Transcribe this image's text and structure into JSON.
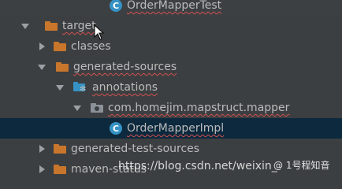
{
  "tree": {
    "rows": [
      {
        "label": "OrderMapperTest",
        "kind": "class",
        "expanded": null
      },
      {
        "label": "target",
        "kind": "folder-excluded",
        "expanded": true
      },
      {
        "label": "classes",
        "kind": "folder-excluded",
        "expanded": false
      },
      {
        "label": "generated-sources",
        "kind": "folder-excluded",
        "expanded": true
      },
      {
        "label": "annotations",
        "kind": "generated-source-root",
        "expanded": true
      },
      {
        "label": "com.homejim.mapstruct.mapper",
        "kind": "package",
        "expanded": true
      },
      {
        "label": "OrderMapperImpl",
        "kind": "class",
        "expanded": null,
        "selected": true
      },
      {
        "label": "generated-test-sources",
        "kind": "folder-excluded",
        "expanded": false
      },
      {
        "label": "maven-status",
        "kind": "folder-excluded",
        "expanded": false
      }
    ]
  },
  "watermark": {
    "url_text": "https://blog.csdn.net/weixin_",
    "badge_text": "@ 1号程知音"
  },
  "colors": {
    "background": "#3c3f41",
    "selection": "#0d293e",
    "folder_excluded": "#c8762c",
    "class_icon": "#3592c4",
    "error_underline": "#d34f4f"
  }
}
